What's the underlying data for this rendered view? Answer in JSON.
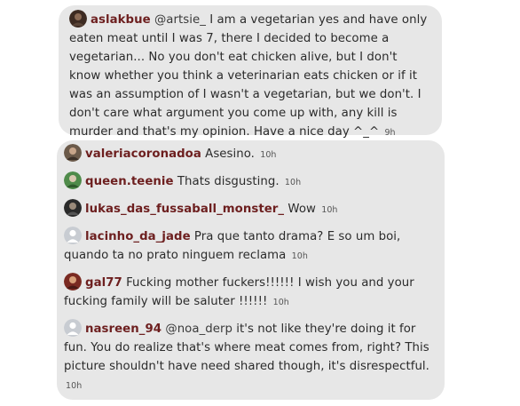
{
  "top_comment": {
    "username": "aslakbue",
    "mention": "@artsie_",
    "text": " I am a vegetarian yes and have only eaten meat until I was 7, there I decided to become a vegetarian... No you don't eat chicken alive, but I don't know whether you think a veterinarian eats chicken or if it was an assumption of I wasn't a vegetarian, but we don't. I don't care what argument you come up with, any kill is murder and that's my opinion. Have a nice day ^_^",
    "time": "9h",
    "avatar_icon": "profile-photo-icon"
  },
  "comments": [
    {
      "username": "valeriacoronadoa",
      "mention": "",
      "text": " Asesino.",
      "time": "10h",
      "avatar_icon": "profile-photo-icon"
    },
    {
      "username": "queen.teenie",
      "mention": "",
      "text": " Thats disgusting.",
      "time": "10h",
      "avatar_icon": "profile-photo-icon"
    },
    {
      "username": "lukas_das_fussaball_monster_",
      "mention": "",
      "text": " Wow",
      "time": "10h",
      "avatar_icon": "profile-photo-icon"
    },
    {
      "username": "lacinho_da_jade",
      "mention": "",
      "text": " Pra que tanto drama? E so um boi, quando ta no prato ninguem reclama",
      "time": "10h",
      "avatar_icon": "default-avatar-icon"
    },
    {
      "username": "gal77",
      "mention": "",
      "text": " Fucking mother fuckers!!!!!! I wish you and your fucking family will be saluter !!!!!!",
      "time": "10h",
      "avatar_icon": "profile-photo-icon"
    },
    {
      "username": "nasreen_94",
      "mention": "@noa_derp",
      "text": " it's not like they're doing it for fun. You do realize that's where meat comes from, right? This picture shouldn't have need shared though, it's disrespectful.",
      "time": "10h",
      "avatar_icon": "default-avatar-icon"
    }
  ],
  "colors": {
    "card_bg": "#e7e7e7",
    "username": "#6d1f1f",
    "text": "#2b2b2b"
  }
}
